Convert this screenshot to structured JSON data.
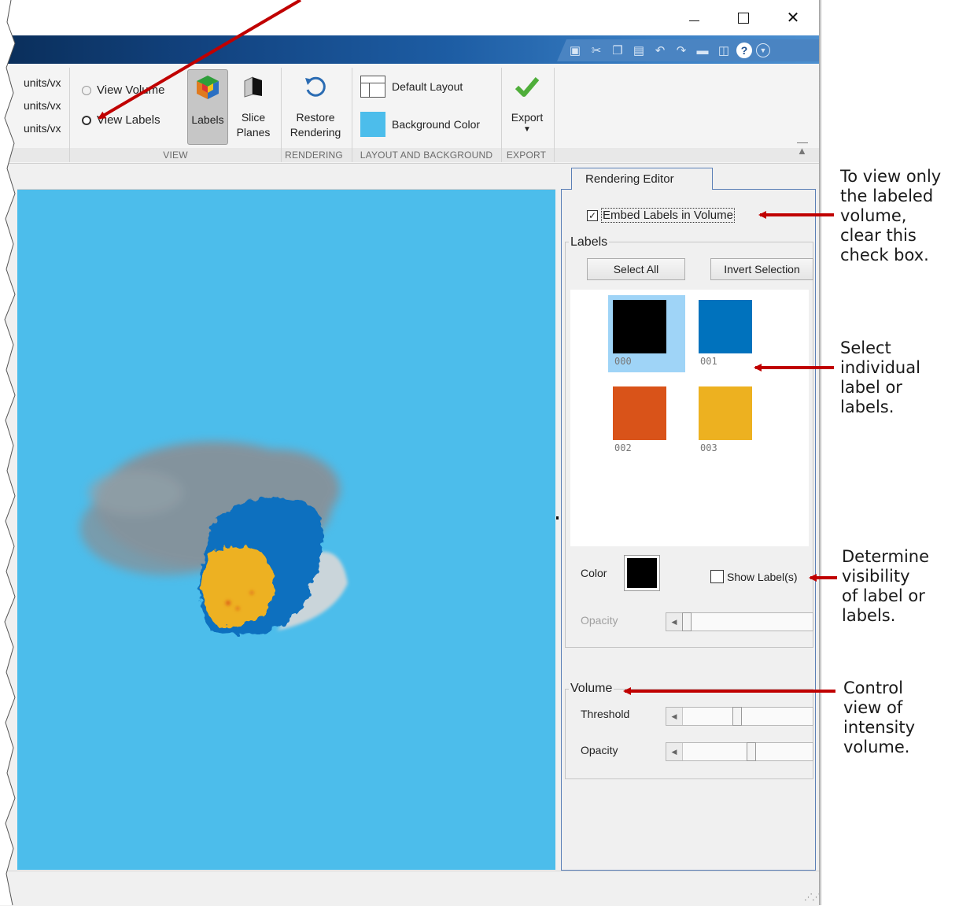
{
  "window": {
    "controls": {
      "minimize": "minimize",
      "maximize": "maximize",
      "close": "close"
    }
  },
  "quick_access": {
    "icons": [
      "save-icon",
      "cut-icon",
      "copy-icon",
      "paste-icon",
      "undo-icon",
      "redo-icon",
      "print-icon",
      "window-icon",
      "help-icon",
      "more-icon"
    ],
    "help_glyph": "?"
  },
  "toolstrip": {
    "units": [
      "units/vx",
      "units/vx",
      "units/vx"
    ],
    "view": {
      "section_label": "VIEW",
      "radio_view_volume": "View Volume",
      "radio_view_labels": "View Labels",
      "selected": "View Labels",
      "labels_button": "Labels",
      "slice_planes_button": "Slice\nPlanes"
    },
    "rendering": {
      "section_label": "RENDERING",
      "restore_button": "Restore\nRendering"
    },
    "layout_background": {
      "section_label": "LAYOUT AND BACKGROUND",
      "default_layout": "Default Layout",
      "background_color": "Background Color",
      "background_swatch": "#4cbdeb"
    },
    "export": {
      "section_label": "EXPORT",
      "export_button": "Export"
    }
  },
  "viewer": {
    "background": "#4cbdeb"
  },
  "rendering_editor": {
    "tab_label": "Rendering Editor",
    "embed_labels": {
      "label": "Embed Labels in Volume",
      "checked": true
    },
    "labels_group": {
      "title": "Labels",
      "select_all": "Select All",
      "invert_selection": "Invert Selection",
      "items": [
        {
          "id": "000",
          "color": "#000000",
          "selected": true
        },
        {
          "id": "001",
          "color": "#0072bd",
          "selected": false
        },
        {
          "id": "002",
          "color": "#d95319",
          "selected": false
        },
        {
          "id": "003",
          "color": "#edb120",
          "selected": false
        }
      ],
      "color_label": "Color",
      "color_value": "#000000",
      "show_labels": {
        "label": "Show Label(s)",
        "checked": false
      },
      "opacity_label": "Opacity",
      "opacity_value": 0
    },
    "volume_group": {
      "title": "Volume",
      "threshold_label": "Threshold",
      "threshold_value": 0.42,
      "opacity_label": "Opacity",
      "opacity_value": 0.53
    }
  },
  "annotations": {
    "embed": "To view only\nthe labeled\nvolume,\nclear this\ncheck box.",
    "select": "Select\nindividual\nlabel or\nlabels.",
    "visibility": "Determine\nvisibility\nof label or\nlabels.",
    "volume": "Control\nview of\nintensity\nvolume."
  }
}
